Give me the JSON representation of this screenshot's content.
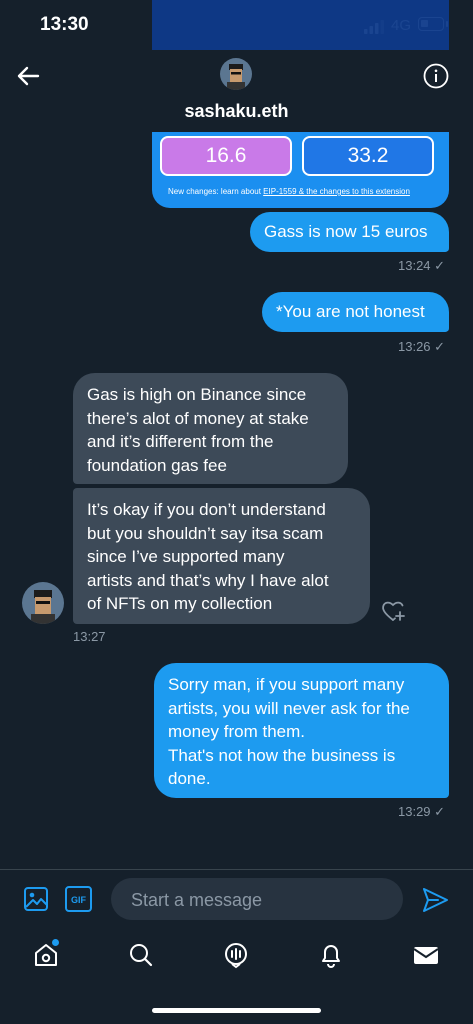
{
  "status_bar": {
    "time": "13:30",
    "network": "4G"
  },
  "header": {
    "name": "sashaku.eth"
  },
  "shared_image": {
    "gas_left": "16.6",
    "gas_right": "33.2",
    "note_prefix": "New changes: learn about ",
    "note_link": "EIP-1559 & the changes to this extension"
  },
  "messages": [
    {
      "id": "gass",
      "direction": "outgoing",
      "lines": [
        "Gass is now 15 euros"
      ],
      "time": "13:24 ✓"
    },
    {
      "id": "honest",
      "direction": "outgoing",
      "lines": [
        "*You are not honest"
      ],
      "time": "13:26 ✓"
    },
    {
      "id": "gas",
      "direction": "incoming",
      "lines": [
        "Gas is high on Binance since",
        "there’s alot of money at stake",
        "and it’s different from the",
        "foundation gas fee"
      ]
    },
    {
      "id": "okay",
      "direction": "incoming",
      "lines": [
        "It’s okay if you don’t understand",
        "but you shouldn’t say itsa scam",
        "since I’ve supported many",
        "artists and that’s why I have alot",
        "of NFTs on my collection"
      ],
      "time": "13:27"
    },
    {
      "id": "sorry",
      "direction": "outgoing",
      "lines": [
        "Sorry man, if you support many",
        "artists, you will never ask for the",
        "money from them.",
        "That's not how the business is",
        "done."
      ],
      "time": "13:29 ✓"
    }
  ],
  "composer": {
    "placeholder": "Start a message",
    "gif_label": "GIF"
  },
  "icons": {
    "back": "arrow-left-icon",
    "info": "info-icon",
    "image": "image-icon",
    "gif": "gif-icon",
    "send": "send-icon",
    "react": "heart-plus-icon",
    "tabs": [
      "home-icon",
      "search-icon",
      "spaces-icon",
      "bell-icon",
      "mail-icon"
    ]
  },
  "colors": {
    "background": "#15202b",
    "accent": "#1d9bf0",
    "incoming_bubble": "#3d4a58",
    "muted": "#8b98a5"
  }
}
